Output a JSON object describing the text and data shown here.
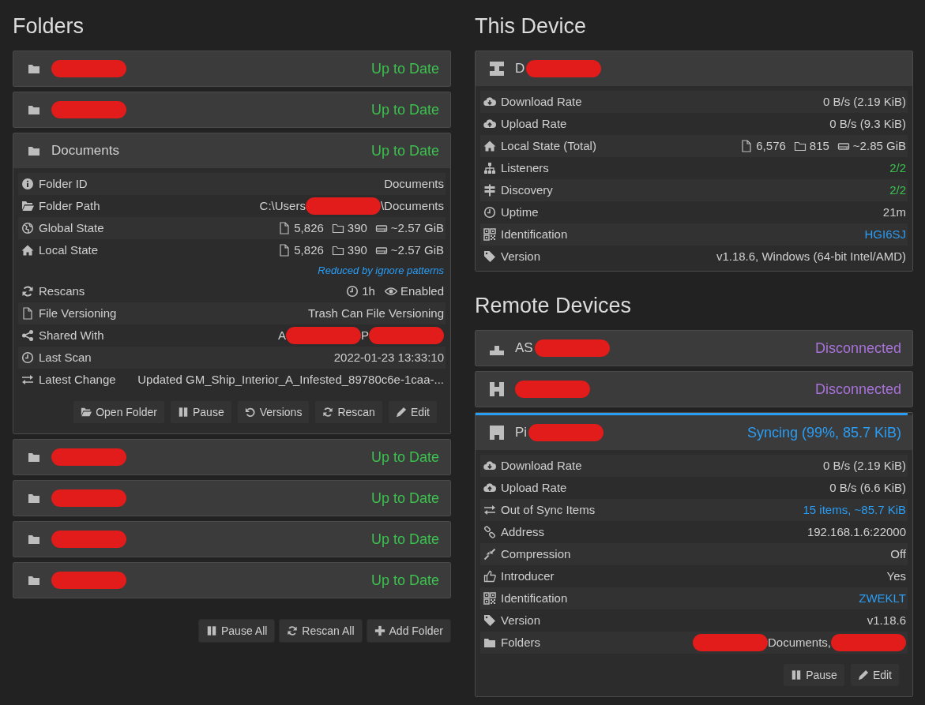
{
  "folders": {
    "title": "Folders",
    "items": [
      {
        "name_parts": [
          {
            "redacted": true
          }
        ],
        "status": "Up to Date",
        "color": "#3cc04e",
        "expanded": false
      },
      {
        "name_parts": [
          {
            "redacted": true
          }
        ],
        "status": "Up to Date",
        "color": "#3cc04e",
        "expanded": false
      },
      {
        "name_parts": [
          {
            "text": "Documents"
          }
        ],
        "status": "Up to Date",
        "color": "#3cc04e",
        "expanded": true,
        "details": [
          {
            "kind": "text",
            "label": "Folder ID",
            "value": "Documents"
          },
          {
            "kind": "parts",
            "label": "Folder Path",
            "parts": [
              {
                "text": "C:\\Users"
              },
              {
                "redacted": true
              },
              {
                "text": "\\Documents"
              }
            ]
          },
          {
            "kind": "stats",
            "label": "Global State",
            "files": "5,826",
            "dirs": "390",
            "size": "~2.57 GiB"
          },
          {
            "kind": "stats",
            "label": "Local State",
            "files": "5,826",
            "dirs": "390",
            "size": "~2.57 GiB",
            "note": "Reduced by ignore patterns"
          },
          {
            "kind": "rescans",
            "label": "Rescans",
            "interval": "1h",
            "watcher": "Enabled"
          },
          {
            "kind": "text",
            "label": "File Versioning",
            "value": "Trash Can File Versioning"
          },
          {
            "kind": "parts",
            "label": "Shared With",
            "parts": [
              {
                "text": "A"
              },
              {
                "redacted": true
              },
              {
                "text": "P"
              },
              {
                "redacted": true
              }
            ]
          },
          {
            "kind": "text",
            "label": "Last Scan",
            "value": "2022-01-23 13:33:10"
          },
          {
            "kind": "text",
            "label": "Latest Change",
            "value": "Updated GM_Ship_Interior_A_Infested_89780c6e-1caa-..."
          }
        ],
        "actions": [
          "Open Folder",
          "Pause",
          "Versions",
          "Rescan",
          "Edit"
        ]
      },
      {
        "name_parts": [
          {
            "redacted": true
          }
        ],
        "status": "Up to Date",
        "color": "#3cc04e",
        "expanded": false
      },
      {
        "name_parts": [
          {
            "redacted": true
          }
        ],
        "status": "Up to Date",
        "color": "#3cc04e",
        "expanded": false
      },
      {
        "name_parts": [
          {
            "redacted": true
          }
        ],
        "status": "Up to Date",
        "color": "#3cc04e",
        "expanded": false
      },
      {
        "name_parts": [
          {
            "redacted": true
          }
        ],
        "status": "Up to Date",
        "color": "#3cc04e",
        "expanded": false
      }
    ],
    "actions": [
      "Pause All",
      "Rescan All",
      "Add Folder"
    ]
  },
  "this_device": {
    "title": "This Device",
    "name_parts": [
      {
        "text": "D"
      },
      {
        "redacted": true
      }
    ],
    "details": [
      {
        "kind": "text",
        "label": "Download Rate",
        "value": "0 B/s (2.19 KiB)"
      },
      {
        "kind": "text",
        "label": "Upload Rate",
        "value": "0 B/s (9.3 KiB)"
      },
      {
        "kind": "stats",
        "label": "Local State (Total)",
        "files": "6,576",
        "dirs": "815",
        "size": "~2.85 GiB"
      },
      {
        "kind": "text",
        "label": "Listeners",
        "value": "2/2",
        "color": "#3cc04e"
      },
      {
        "kind": "text",
        "label": "Discovery",
        "value": "2/2",
        "color": "#3cc04e"
      },
      {
        "kind": "text",
        "label": "Uptime",
        "value": "21m"
      },
      {
        "kind": "text",
        "label": "Identification",
        "value": "HGI6SJ",
        "color": "#2a9df4"
      },
      {
        "kind": "text",
        "label": "Version",
        "value": "v1.18.6, Windows (64-bit Intel/AMD)"
      }
    ]
  },
  "remote_devices": {
    "title": "Remote Devices",
    "items": [
      {
        "name_parts": [
          {
            "text": "AS"
          },
          {
            "redacted": true
          }
        ],
        "status": "Disconnected",
        "color": "#a872d8",
        "expanded": false
      },
      {
        "name_parts": [
          {
            "redacted": true
          }
        ],
        "status": "Disconnected",
        "color": "#a872d8",
        "expanded": false
      },
      {
        "name_parts": [
          {
            "text": "Pi"
          },
          {
            "redacted": true
          }
        ],
        "status": "Syncing (99%, 85.7 KiB)",
        "color": "#2a9df4",
        "level": 0.99,
        "expanded": true,
        "details": [
          {
            "kind": "text",
            "label": "Download Rate",
            "value": "0 B/s (2.19 KiB)"
          },
          {
            "kind": "text",
            "label": "Upload Rate",
            "value": "0 B/s (6.6 KiB)"
          },
          {
            "kind": "text",
            "label": "Out of Sync Items",
            "value": "15 items, ~85.7 KiB",
            "color": "#2a9df4"
          },
          {
            "kind": "text",
            "label": "Address",
            "value": "192.168.1.6:22000"
          },
          {
            "kind": "text",
            "label": "Compression",
            "value": "Off"
          },
          {
            "kind": "text",
            "label": "Introducer",
            "value": "Yes"
          },
          {
            "kind": "text",
            "label": "Identification",
            "value": "ZWEKLT",
            "color": "#2a9df4"
          },
          {
            "kind": "text",
            "label": "Version",
            "value": "v1.18.6"
          },
          {
            "kind": "parts",
            "label": "Folders",
            "parts": [
              {
                "redacted": true
              },
              {
                "text": "Documents,"
              },
              {
                "redacted": true
              }
            ]
          }
        ],
        "actions": [
          "Pause",
          "Edit"
        ]
      }
    ]
  }
}
